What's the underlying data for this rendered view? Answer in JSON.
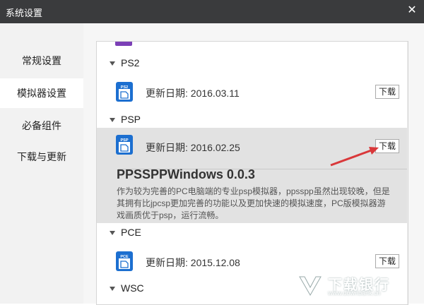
{
  "window": {
    "title": "系统设置",
    "close_icon": "close-icon"
  },
  "sidebar": {
    "items": [
      {
        "label": "常规设置"
      },
      {
        "label": "模拟器设置"
      },
      {
        "label": "必备组件"
      },
      {
        "label": "下载与更新"
      }
    ],
    "active_index": 1
  },
  "content": {
    "categories": {
      "ps2": "PS2",
      "psp": "PSP",
      "pce": "PCE",
      "wsc": "WSC"
    },
    "rows": [
      {
        "icon_label": "PS2",
        "date": "更新日期: 2016.03.11",
        "button": "下载"
      },
      {
        "icon_label": "PSP",
        "date": "更新日期: 2016.02.25",
        "button": "下载"
      },
      {
        "icon_label": "PCE",
        "date": "更新日期: 2015.12.08",
        "button": "下载"
      }
    ],
    "psp_detail": {
      "name": "PPSSPPWindows 0.0.3",
      "description": "作为较为完善的PC电脑端的专业psp模拟器，ppsspp虽然出现较晚，但是其拥有比jpcsp更加完善的功能以及更加快速的模拟速度，PC版模拟器游戏画质优于psp，运行流畅。"
    }
  },
  "watermark": {
    "text": "下载银行",
    "url": "www.downbank.cn"
  },
  "colors": {
    "titlebar": "#3a3b3d",
    "icon_blue": "#1c6fd0",
    "arrow": "#d9383a",
    "expanded_bg": "#e2e2e2"
  }
}
